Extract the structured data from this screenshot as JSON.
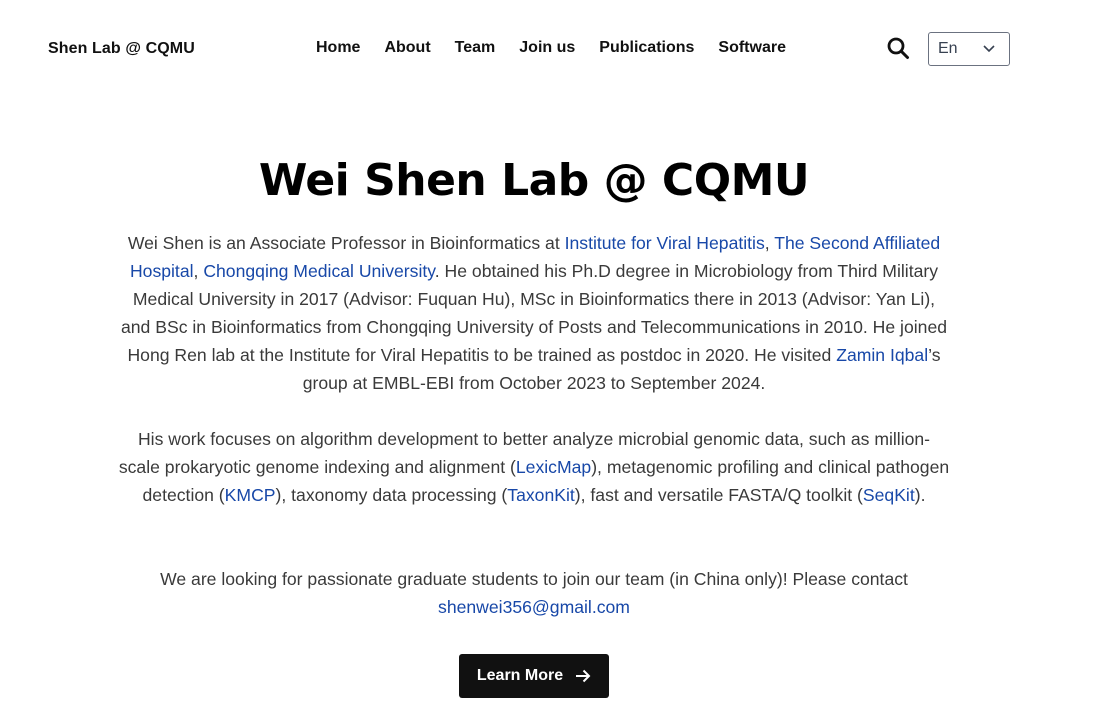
{
  "brand": "Shen Lab @ CQMU",
  "nav": [
    "Home",
    "About",
    "Team",
    "Join us",
    "Publications",
    "Software"
  ],
  "language": {
    "selected": "En"
  },
  "icons": {
    "search": "search-icon",
    "language_chevron": "chevron-down-icon",
    "cta_arrow": "arrow-right-icon"
  },
  "colors": {
    "link": "#1848a8",
    "button_bg": "#111111",
    "text": "#3a3a3a"
  },
  "hero": {
    "title": "Wei Shen Lab @ CQMU"
  },
  "bio": {
    "p1": {
      "t1": "Wei Shen is an Associate Professor in Bioinformatics at ",
      "link_ivh": "Institute for Viral Hepatitis",
      "sep1": ", ",
      "link_hospital": "The Second Affiliated Hospital",
      "sep2": ", ",
      "link_cqmu": "Chongqing Medical University",
      "t2": ". He obtained his Ph.D degree in Microbiology from Third Military Medical University in 2017 (Advisor: Fuquan Hu), MSc in Bioinformatics there in 2013 (Advisor: Yan Li), and BSc in Bioinformatics from Chongqing University of Posts and Telecommunications in 2010. He joined Hong Ren lab at the Institute for Viral Hepatitis to be trained as postdoc in 2020. He visited ",
      "link_zamin": "Zamin Iqbal",
      "t3": "’s group at EMBL-EBI from October 2023 to September 2024."
    },
    "p2": {
      "t1": "His work focuses on algorithm development to better analyze microbial genomic data, such as million-scale prokaryotic genome indexing and alignment (",
      "link_lexicmap": "LexicMap",
      "t2": "), metagenomic profiling and clinical pathogen detection (",
      "link_kmcp": "KMCP",
      "t3": "), taxonomy data processing (",
      "link_taxonkit": "TaxonKit",
      "t4": "), fast and versatile FASTA/Q toolkit (",
      "link_seqkit": "SeqKit",
      "t5": ")."
    },
    "p3": {
      "t1": "We are looking for passionate graduate students to join our team (in China only)! Please contact ",
      "email": "shenwei356@gmail.com"
    }
  },
  "cta": {
    "label": "Learn More"
  }
}
